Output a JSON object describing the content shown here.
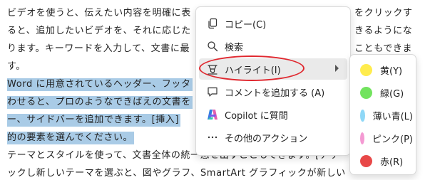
{
  "document": {
    "lines": [
      {
        "text": "ビデオを使うと、伝えたい内容を明確に表",
        "selected": false
      },
      {
        "text": "ると、追加したいビデオを、それに応じた",
        "selected": false
      },
      {
        "text": "ります。キーワードを入力して、文書に最",
        "selected": false
      },
      {
        "text": "す。",
        "selected": false
      },
      {
        "text": "Word に用意されているヘッダー、フッタ",
        "selected": true
      },
      {
        "text": "わせると、プロのようなできばえの文書を",
        "selected": true
      },
      {
        "text": "ー、サイドバーを追加できます。[挿入]",
        "selected": true
      },
      {
        "text": "的の要素を選んでください。",
        "selected": true
      },
      {
        "text": "テーマとスタイルを使って、文書全体の統一感を出すこともできます。[デザ",
        "selected": false
      },
      {
        "text": "ックし新しいテーマを選ぶと、図やグラフ、SmartArt グラフィックが新しい",
        "selected": false
      }
    ],
    "right_fragments": [
      {
        "text": "をクリックす"
      },
      {
        "text": "きるようにな"
      },
      {
        "text": "こともできま"
      }
    ]
  },
  "context_menu": {
    "items": [
      {
        "label": "コピー(C)",
        "icon": "copy-icon",
        "submenu": false,
        "active": false
      },
      {
        "label": "検索",
        "icon": "search-icon",
        "submenu": false,
        "active": false
      },
      {
        "label": "ハイライト(I)",
        "icon": "highlighter-icon",
        "submenu": true,
        "active": true
      },
      {
        "label": "コメントを追加する (A)",
        "icon": "comment-icon",
        "submenu": false,
        "active": false
      },
      {
        "label": "Copilot に質問",
        "icon": "copilot-icon",
        "submenu": false,
        "active": false
      },
      {
        "label": "その他のアクション",
        "icon": "more-icon",
        "submenu": false,
        "active": false
      }
    ]
  },
  "highlight_submenu": {
    "items": [
      {
        "label": "黄(Y)",
        "color": "#ffec4d"
      },
      {
        "label": "緑(G)",
        "color": "#72e35e"
      },
      {
        "label": "薄い青(L)",
        "color": "#8fd8f7"
      },
      {
        "label": "ピンク(P)",
        "color": "#f49ad3"
      },
      {
        "label": "赤(R)",
        "color": "#e84848"
      }
    ]
  },
  "colors": {
    "selection": "#a9cbe6",
    "annotation": "#e0282f"
  }
}
